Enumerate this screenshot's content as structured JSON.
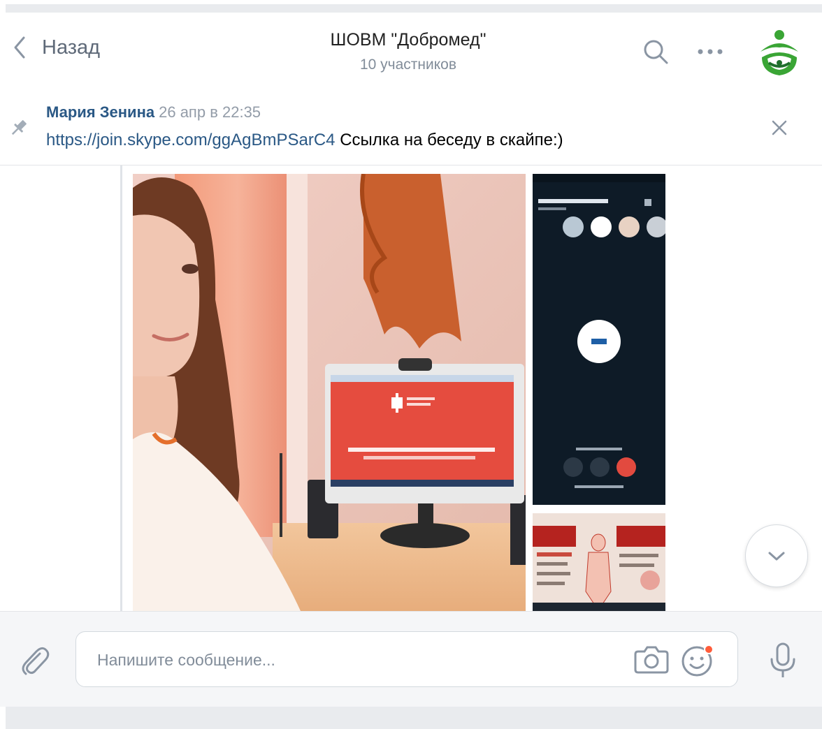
{
  "header": {
    "back_label": "Назад",
    "title": "ШОВМ \"Добромед\"",
    "subtitle": "10 участников",
    "icons": [
      "chevron-left-icon",
      "search-icon",
      "more-icon",
      "avatar"
    ]
  },
  "pinned": {
    "author": "Мария Зенина",
    "date": "26 апр в 22:35",
    "link": "https://join.skype.com/ggAgBmPSarC4",
    "text": " Ссылка на беседу в скайпе:)",
    "icons": [
      "pin-icon",
      "close-icon"
    ]
  },
  "attachments": [
    {
      "name": "photo-main"
    },
    {
      "name": "photo-phone-screenshot"
    },
    {
      "name": "photo-poster"
    }
  ],
  "composer": {
    "placeholder": "Напишите сообщение...",
    "icons": [
      "paperclip-icon",
      "camera-icon",
      "smile-icon",
      "microphone-icon"
    ]
  },
  "colors": {
    "link": "#2a5885",
    "secondary_text": "#818c99",
    "accent": "#4a76a8",
    "logo_green": "#3aa535"
  }
}
